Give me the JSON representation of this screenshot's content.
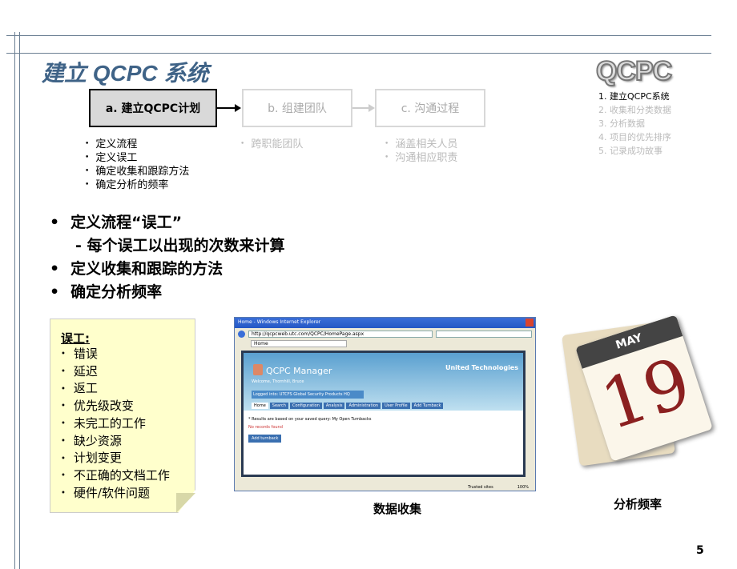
{
  "title": "建立 QCPC 系统",
  "steps": [
    {
      "label": "a. 建立QCPC计划"
    },
    {
      "label": "b. 组建团队"
    },
    {
      "label": "c. 沟通过程"
    }
  ],
  "step_bullets": [
    [
      "定义流程",
      "定义误工",
      "确定收集和跟踪方法",
      "确定分析的频率"
    ],
    [
      "跨职能团队"
    ],
    [
      "涵盖相关人员",
      "沟通相应职责"
    ]
  ],
  "logo": "QCPC",
  "nav": [
    "1. 建立QCPC系统",
    "2. 收集和分类数据",
    "3. 分析数据",
    "4. 项目的优先排序",
    "5. 记录成功故事"
  ],
  "main": [
    "定义流程“误工”",
    "- 每个误工以出现的次数来计算",
    "定义收集和跟踪的方法",
    "确定分析频率"
  ],
  "note": {
    "title": "误工:",
    "items": [
      "错误",
      "延迟",
      "返工",
      "优先级改变",
      "未完工的工作",
      "缺少资源",
      "计划变更",
      "不正确的文档工作",
      "硬件/软件问题"
    ]
  },
  "screenshot": {
    "window_title": "Home - Windows Internet Explorer",
    "url": "http://qcpcweb.utc.com/QCPC/HomePage.aspx",
    "tab": "Home",
    "app_name": "QCPC Manager",
    "brand": "United Technologies",
    "welcome": "Welcome, Thornhill, Bruce",
    "logged": "Logged into: UTCFS Global Security Products HQ",
    "nav_tabs": [
      "Home",
      "Search",
      "Configuration",
      "Analysis",
      "Administration",
      "User Profile",
      "Add Turnback"
    ],
    "results_note": "* Results are based on your saved query:",
    "query": "My Open Turnbacks",
    "no_records": "No records found",
    "add_button": "Add turnback",
    "status": "Trusted sites",
    "zoom": "100%"
  },
  "calendar": {
    "month": "MAY",
    "day": "19"
  },
  "captions": {
    "screenshot": "数据收集",
    "calendar": "分析频率"
  },
  "page_number": "5"
}
